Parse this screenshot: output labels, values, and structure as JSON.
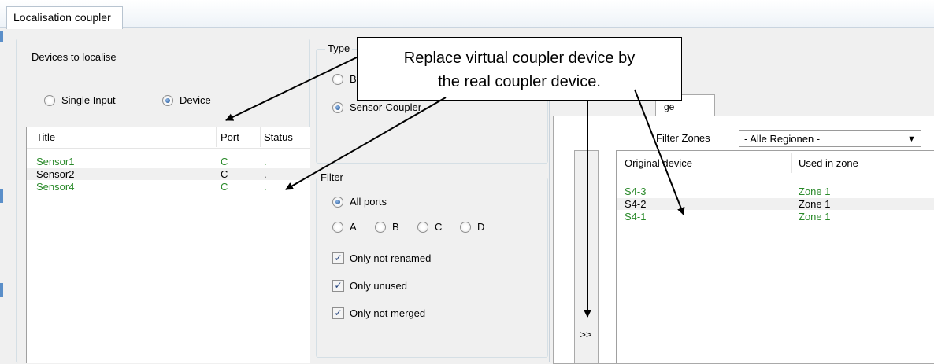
{
  "window": {
    "title": "Localisation coupler"
  },
  "devices_group": {
    "label": "Devices to localise",
    "radio_single": "Single Input",
    "radio_device": "Device",
    "selected": "Device",
    "columns": [
      "Title",
      "Port",
      "Status"
    ],
    "rows": [
      {
        "title": "Sensor1",
        "port": "C",
        "status": ".",
        "color": "#2a8a2a"
      },
      {
        "title": "Sensor2",
        "port": "C",
        "status": ".",
        "color": "#000000"
      },
      {
        "title": "Sensor4",
        "port": "C",
        "status": ".",
        "color": "#2a8a2a"
      }
    ]
  },
  "type_group": {
    "label": "Type",
    "option_bus": "Bu",
    "option_sensor_coupler": "Sensor-Coupler",
    "selected": "Sensor-Coupler"
  },
  "filter_group": {
    "label": "Filter",
    "all_ports": "All ports",
    "ports": [
      "A",
      "B",
      "C",
      "D"
    ],
    "only_not_renamed": "Only not renamed",
    "only_unused": "Only unused",
    "only_not_merged": "Only not merged",
    "checked": [
      true,
      true,
      true
    ]
  },
  "right_panel": {
    "tab_label": "ge",
    "filter_zones_label": "Filter Zones",
    "filter_zones_value": "- Alle Regionen -",
    "columns": [
      "Original device",
      "Used in zone"
    ],
    "rows": [
      {
        "device": "S4-3",
        "zone": "Zone 1",
        "color": "#2a8a2a"
      },
      {
        "device": "S4-2",
        "zone": "Zone 1",
        "color": "#000000"
      },
      {
        "device": "S4-1",
        "zone": "Zone 1",
        "color": "#2a8a2a"
      }
    ],
    "move_button": ">>"
  },
  "callout": {
    "line1": "Replace virtual coupler device by",
    "line2": "the real coupler device."
  },
  "icons": {
    "checkmark": "✓",
    "dropdown": "▼"
  }
}
